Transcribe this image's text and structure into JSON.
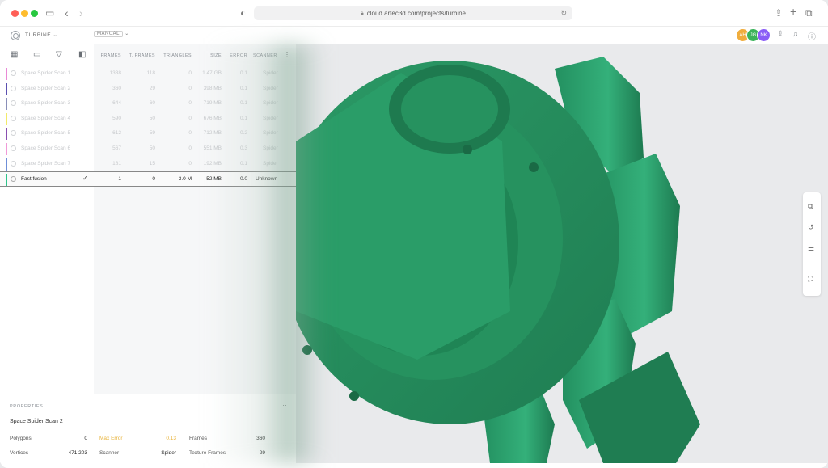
{
  "browser": {
    "url": "cloud.artec3d.com/projects/turbine"
  },
  "header": {
    "project": "TURBINE",
    "mode": "MANUAL",
    "avatars": [
      {
        "initials": "AH",
        "color": "#f0ad3d"
      },
      {
        "initials": "JG",
        "color": "#3bb35a"
      },
      {
        "initials": "NK",
        "color": "#8a5cf6"
      }
    ]
  },
  "table": {
    "columns": [
      "FRAMES",
      "T. FRAMES",
      "TRIANGLES",
      "SIZE",
      "ERROR",
      "SCANNER"
    ],
    "rows": [
      {
        "name": "Space Spider Scan 1",
        "frames": "1338",
        "tframes": "118",
        "triangles": "0",
        "size": "1.47 GB",
        "error": "0.1",
        "scanner": "Spider",
        "color": "#e98ad6"
      },
      {
        "name": "Space Spider Scan 2",
        "frames": "360",
        "tframes": "29",
        "triangles": "0",
        "size": "398 MB",
        "error": "0.1",
        "scanner": "Spider",
        "color": "#5b4fb0"
      },
      {
        "name": "Space Spider Scan 3",
        "frames": "644",
        "tframes": "60",
        "triangles": "0",
        "size": "719 MB",
        "error": "0.1",
        "scanner": "Spider",
        "color": "#8a8fb8"
      },
      {
        "name": "Space Spider Scan 4",
        "frames": "590",
        "tframes": "50",
        "triangles": "0",
        "size": "676 MB",
        "error": "0.1",
        "scanner": "Spider",
        "color": "#f2ea6a"
      },
      {
        "name": "Space Spider Scan 5",
        "frames": "612",
        "tframes": "59",
        "triangles": "0",
        "size": "712 MB",
        "error": "0.2",
        "scanner": "Spider",
        "color": "#8a4fb0"
      },
      {
        "name": "Space Spider Scan 6",
        "frames": "567",
        "tframes": "50",
        "triangles": "0",
        "size": "551 MB",
        "error": "0.3",
        "scanner": "Spider",
        "color": "#f09ad8"
      },
      {
        "name": "Space Spider Scan 7",
        "frames": "181",
        "tframes": "15",
        "triangles": "0",
        "size": "192 MB",
        "error": "0.1",
        "scanner": "Spider",
        "color": "#6f8fd8"
      },
      {
        "name": "Fast fusion",
        "frames": "1",
        "tframes": "0",
        "triangles": "3.0 M",
        "size": "52 MB",
        "error": "0.0",
        "scanner": "Unknown",
        "color": "#2fc38a",
        "check": "✓"
      }
    ]
  },
  "properties": {
    "title": "PROPERTIES",
    "name": "Space Spider Scan 2",
    "polygons_label": "Polygons",
    "polygons": "0",
    "max_error_label": "Max Error",
    "max_error": "0.13",
    "frames_label": "Frames",
    "frames": "360",
    "vertices_label": "Vertices",
    "vertices": "471 203",
    "scanner_label": "Scanner",
    "scanner": "Spider",
    "texture_frames_label": "Texture Frames",
    "texture_frames": "29"
  },
  "viewport": {
    "model_color": "#2a9d68"
  }
}
